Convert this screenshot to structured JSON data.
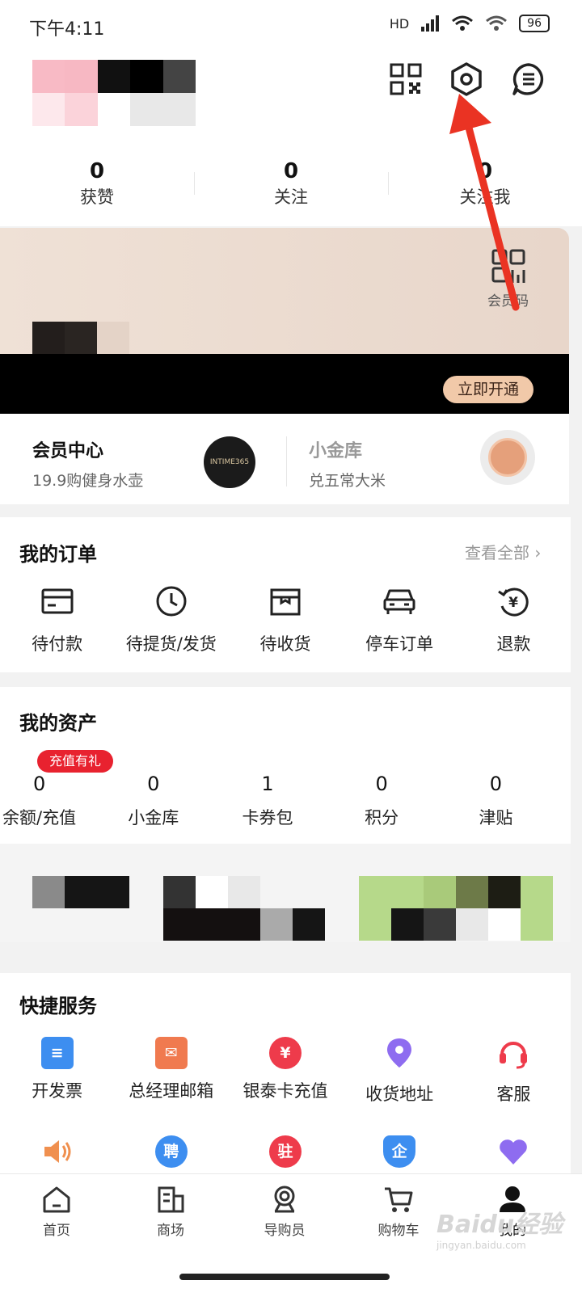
{
  "status_bar": {
    "time": "下午4:11",
    "network": "HD",
    "battery": "96"
  },
  "header": {
    "icons": [
      "qr-code-icon",
      "settings-hex-icon",
      "message-icon"
    ]
  },
  "stats": [
    {
      "value": "0",
      "label": "获赞"
    },
    {
      "value": "0",
      "label": "关注"
    },
    {
      "value": "0",
      "label": "关注我"
    }
  ],
  "member_card": {
    "code_label": "会员码",
    "open_button": "立即开通"
  },
  "member_row": {
    "left_title": "会员中心",
    "left_sub": "19.9购健身水壶",
    "badge_text": "INTIME365",
    "right_title": "小金库",
    "right_sub": "兑五常大米"
  },
  "orders": {
    "title": "我的订单",
    "view_all": "查看全部",
    "items": [
      {
        "label": "待付款",
        "icon": "card-icon"
      },
      {
        "label": "待提货/发货",
        "icon": "clock-icon"
      },
      {
        "label": "待收货",
        "icon": "box-icon"
      },
      {
        "label": "停车订单",
        "icon": "car-icon"
      },
      {
        "label": "退款",
        "icon": "refund-icon"
      }
    ]
  },
  "assets": {
    "title": "我的资产",
    "promo_tag": "充值有礼",
    "items": [
      {
        "value": "0",
        "label": "余额/充值"
      },
      {
        "value": "0",
        "label": "小金库"
      },
      {
        "value": "1",
        "label": "卡券包"
      },
      {
        "value": "0",
        "label": "积分"
      },
      {
        "value": "0",
        "label": "津贴"
      }
    ]
  },
  "quick_services": {
    "title": "快捷服务",
    "row1": [
      {
        "label": "开发票",
        "icon": "invoice-icon",
        "color": "#3d8ef0"
      },
      {
        "label": "总经理邮箱",
        "icon": "mailbox-icon",
        "color": "#f07a4f"
      },
      {
        "label": "银泰卡充值",
        "icon": "yen-icon",
        "glyph": "¥",
        "color": "#ee3b4b"
      },
      {
        "label": "收货地址",
        "icon": "location-icon",
        "color": "#8e6cf0"
      },
      {
        "label": "客服",
        "icon": "headset-icon",
        "color": "#ee3b4b"
      }
    ],
    "row2": [
      {
        "icon": "speaker-icon",
        "color": "#f0904f"
      },
      {
        "icon": "hire-icon",
        "glyph": "聘",
        "color": "#3d8ef0"
      },
      {
        "icon": "station-icon",
        "glyph": "驻",
        "color": "#ee3b4b"
      },
      {
        "icon": "enterprise-icon",
        "glyph": "企",
        "color": "#3d8ef0"
      },
      {
        "icon": "heart-icon",
        "color": "#8e6cf0"
      }
    ]
  },
  "bottom_nav": [
    {
      "label": "首页",
      "icon": "home-icon"
    },
    {
      "label": "商场",
      "icon": "mall-icon"
    },
    {
      "label": "导购员",
      "icon": "guide-icon"
    },
    {
      "label": "购物车",
      "icon": "cart-icon"
    },
    {
      "label": "我的",
      "icon": "profile-icon"
    }
  ],
  "watermark": {
    "brand": "Baidu经验",
    "url": "jingyan.baidu.com"
  },
  "colors": {
    "accent_red": "#e8222f",
    "annotation_arrow": "#ea3323",
    "card_bg": "#ecdcd1",
    "open_button_bg": "#f1c9a9"
  }
}
